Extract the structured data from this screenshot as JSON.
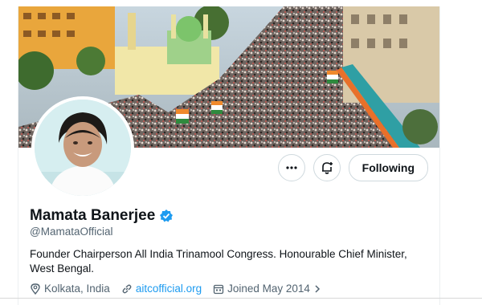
{
  "profile": {
    "name": "Mamata Banerjee",
    "handle": "@MamataOfficial",
    "bio": "Founder Chairperson All India Trinamool Congress. Honourable Chief Minister, West Bengal.",
    "location": "Kolkata, India",
    "website": "aitcofficial.org",
    "joined": "Joined May 2014",
    "verified": true
  },
  "actions": {
    "follow_label": "Following",
    "more_icon": "more-horizontal-icon",
    "notify_icon": "bell-plus-icon"
  },
  "colors": {
    "accent": "#1d9bf0",
    "text": "#0f1419",
    "muted": "#536471",
    "border": "#cfd9de"
  }
}
